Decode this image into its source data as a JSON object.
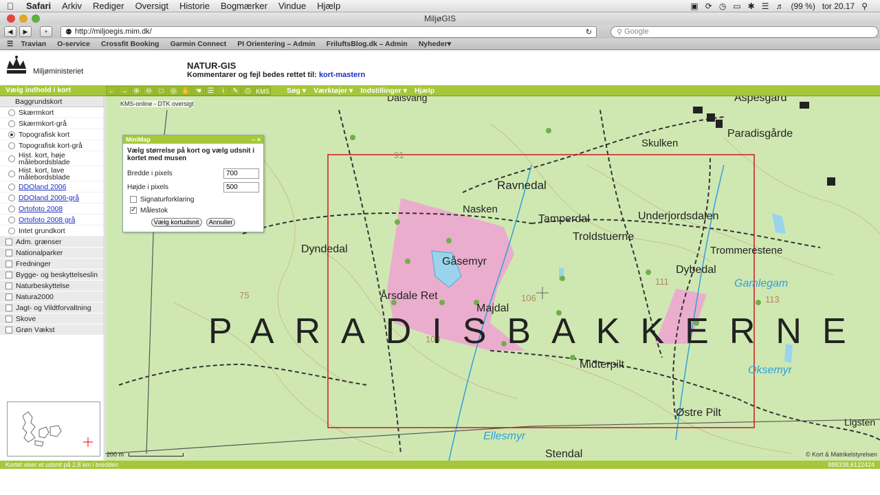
{
  "menubar": {
    "app": "Safari",
    "items": [
      "Arkiv",
      "Rediger",
      "Oversigt",
      "Historie",
      "Bogmærker",
      "Vindue",
      "Hjælp"
    ],
    "battery": "(99 %)",
    "clock": "tor 20.17"
  },
  "window": {
    "title": "MiljøGIS"
  },
  "browser": {
    "url": "http://miljoegis.mim.dk/",
    "search_placeholder": "Google",
    "bookmarks": [
      "Travian",
      "O-service",
      "Crossfit Booking",
      "Garmin Connect",
      "PI Orientering – Admin",
      "FriluftsBlog.dk – Admin",
      "Nyheder▾"
    ]
  },
  "site": {
    "ministry": "Miljøministeriet",
    "app_title": "NATUR-GIS",
    "comment_prefix": "Kommentarer og fejl bedes rettet til:",
    "comment_link": "kort-mastern"
  },
  "toolbar": {
    "content_label": "Vælg indhold i kort",
    "kms_label": "KMS",
    "menus": [
      "Søg ▾",
      "Værktøjer ▾",
      "Indstillinger ▾",
      "Hjælp"
    ]
  },
  "sidebar": {
    "section": "Baggrundskort",
    "radios": [
      {
        "label": "Skærmkort",
        "on": false,
        "link": false
      },
      {
        "label": "Skærmkort-grå",
        "on": false,
        "link": false
      },
      {
        "label": "Topografisk kort",
        "on": true,
        "link": false
      },
      {
        "label": "Topografisk kort-grå",
        "on": false,
        "link": false
      },
      {
        "label": "Hist. kort, høje målebordsblade",
        "on": false,
        "link": false
      },
      {
        "label": "Hist. kort, lave målebordsblade",
        "on": false,
        "link": false
      },
      {
        "label": "DDOland 2006",
        "on": false,
        "link": true
      },
      {
        "label": "DDOland 2006-grå",
        "on": false,
        "link": true
      },
      {
        "label": "Ortofoto 2008",
        "on": false,
        "link": true
      },
      {
        "label": "Ortofoto 2008 grå",
        "on": false,
        "link": true
      },
      {
        "label": "Intet grundkort",
        "on": false,
        "link": false
      }
    ],
    "checks": [
      "Adm. grænser",
      "Nationalparker",
      "Fredninger",
      "Bygge- og beskyttelseslin",
      "Naturbeskyttelse",
      "Natura2000",
      "Jagt- og Vildtforvaltning",
      "Skove",
      "Grøn Vækst"
    ]
  },
  "map": {
    "caption": "KMS-online - DTK oversigt",
    "scale": "200 m",
    "credit": "© Kort & Matrikelstyrelsen",
    "places": [
      "Dalsvang",
      "Aspesgård",
      "Paradisgårde",
      "Skulken",
      "Ravnedal",
      "Nasken",
      "Tamperdal",
      "Underjordsdalen",
      "Troldstuerne",
      "Trommerestene",
      "Dyndedal",
      "Gåsemyr",
      "Dybedal",
      "Gamlegam",
      "Årsdale Ret",
      "Majdal",
      "Midterpilt",
      "Oksemyr",
      "Østre Pilt",
      "Ellesmyr",
      "Stendal",
      "Ligsten"
    ],
    "region_label": "PARADISBAKKERNE",
    "heights": [
      "91",
      "106",
      "109",
      "111",
      "113",
      "75"
    ]
  },
  "minimap": {
    "title": "MiniMap",
    "intro": "Vælg størrelse på kort og vælg udsnit i kortet med musen",
    "width_label": "Bredde i pixels",
    "width_value": "700",
    "height_label": "Højde i pixels",
    "height_value": "500",
    "legend_label": "Signaturforklaring",
    "legend_checked": false,
    "scale_label": "Målestok",
    "scale_checked": true,
    "select_button": "Vælg kortudsnit",
    "cancel_button": "Annuller"
  },
  "status": {
    "text": "Kortet viser et udsnit på 2.8 km i bredden",
    "coords": "888338,6122424"
  }
}
